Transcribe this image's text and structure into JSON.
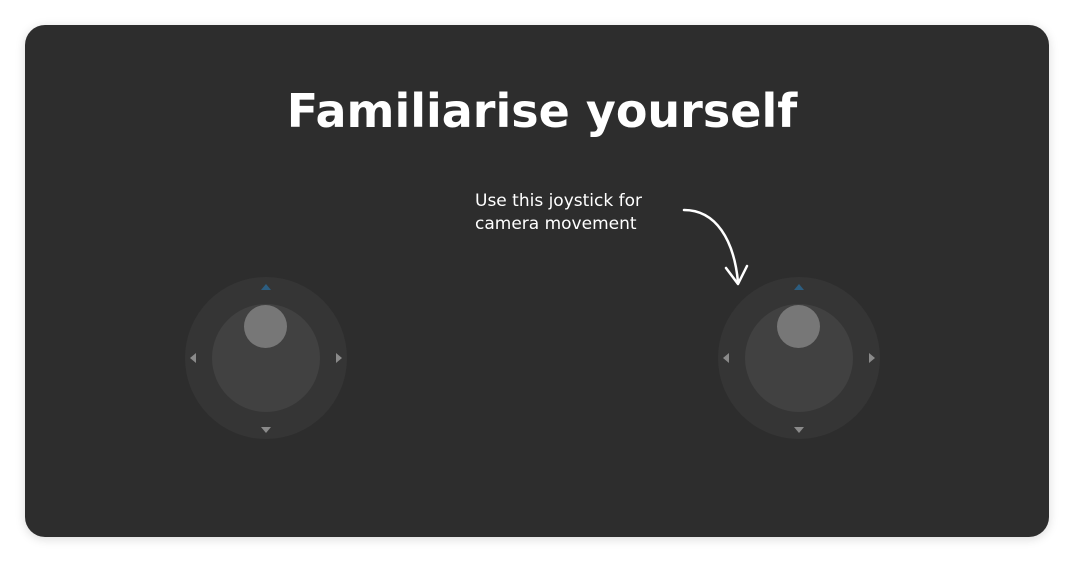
{
  "title": "Familiarise yourself",
  "hint": {
    "line1": "Use this joystick for",
    "line2": "camera movement"
  },
  "colors": {
    "card_background": "#2d2d2d",
    "active_direction": "#2c5d80",
    "direction_arrow": "#8a8a8a",
    "knob": "#777777"
  },
  "joysticks": [
    {
      "role": "movement",
      "icons": [
        "arrow-up-icon",
        "arrow-down-icon",
        "arrow-left-icon",
        "arrow-right-icon"
      ]
    },
    {
      "role": "camera",
      "icons": [
        "arrow-up-icon",
        "arrow-down-icon",
        "arrow-left-icon",
        "arrow-right-icon"
      ]
    }
  ]
}
